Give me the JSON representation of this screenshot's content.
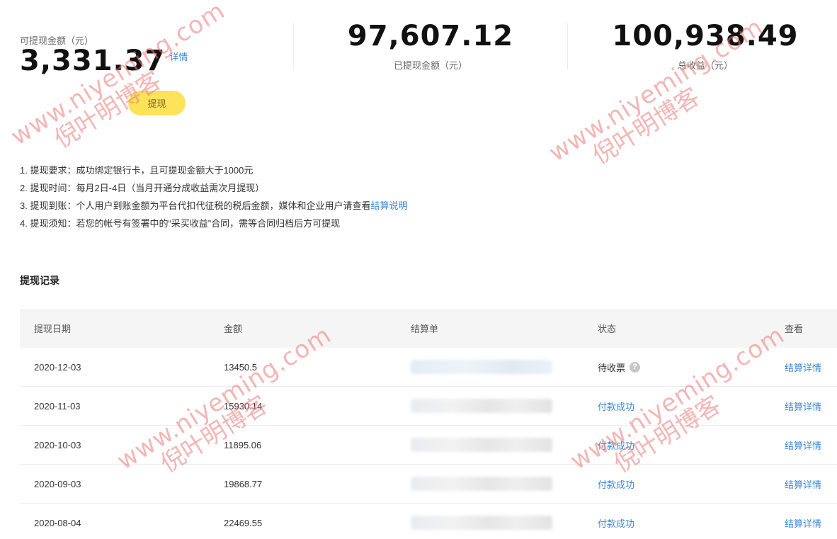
{
  "summary": {
    "available_label": "可提现金额（元）",
    "available_amount": "3,331.37",
    "detail_link": "详情",
    "withdraw_button": "提现",
    "withdrawn_amount": "97,607.12",
    "withdrawn_label": "已提现金额（元）",
    "total_amount": "100,938.49",
    "total_label": "总收益（元）"
  },
  "rules": {
    "r1": "1. 提现要求：成功绑定银行卡，且可提现金额大于1000元",
    "r2": "2. 提现时间：每月2日-4日（当月开通分成收益需次月提现）",
    "r3_prefix": "3. 提现到账：个人用户到账金额为平台代扣代征税的税后金额，媒体和企业用户请查看",
    "r3_link": "结算说明",
    "r4": "4. 提现须知：若您的帐号有签署中的“采买收益”合同，需等合同归档后方可提现"
  },
  "records": {
    "title": "提现记录",
    "headers": {
      "date": "提现日期",
      "amount": "金额",
      "bill": "结算单",
      "status": "状态",
      "view": "查看"
    },
    "rows": [
      {
        "date": "2020-12-03",
        "amount": "13450.5",
        "status": "待收票",
        "view": "结算详情"
      },
      {
        "date": "2020-11-03",
        "amount": "15930.14",
        "status": "付款成功",
        "view": "结算详情"
      },
      {
        "date": "2020-10-03",
        "amount": "11895.06",
        "status": "付款成功",
        "view": "结算详情"
      },
      {
        "date": "2020-09-03",
        "amount": "19868.77",
        "status": "付款成功",
        "view": "结算详情"
      },
      {
        "date": "2020-08-04",
        "amount": "22469.55",
        "status": "付款成功",
        "view": "结算详情"
      }
    ]
  },
  "watermark": {
    "en": "www.niyeming.com",
    "cn": "倪叶明博客"
  },
  "colors": {
    "accent_link": "#3a86d4",
    "withdraw_button": "#fde25a",
    "watermark": "#eb7878"
  },
  "icons": {
    "help": "question-circle-icon"
  }
}
